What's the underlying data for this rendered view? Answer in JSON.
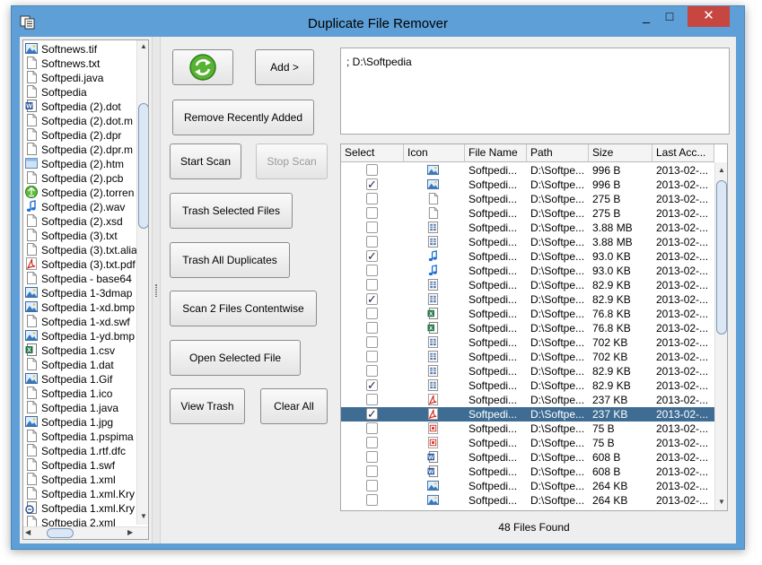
{
  "window": {
    "title": "Duplicate File Remover",
    "minimize": "_",
    "maximize": "□",
    "close": "✕"
  },
  "file_list": [
    {
      "name": "Softnews.tif",
      "icon": "image-icon"
    },
    {
      "name": "Softnews.txt",
      "icon": "text-file-icon"
    },
    {
      "name": "Softpedi.java",
      "icon": "text-file-icon"
    },
    {
      "name": "Softpedia",
      "icon": "text-file-icon"
    },
    {
      "name": "Softpedia (2).dot",
      "icon": "word-document-icon"
    },
    {
      "name": "Softpedia (2).dot.m",
      "icon": "text-file-icon"
    },
    {
      "name": "Softpedia (2).dpr",
      "icon": "text-file-icon"
    },
    {
      "name": "Softpedia (2).dpr.m",
      "icon": "text-file-icon"
    },
    {
      "name": "Softpedia (2).htm",
      "icon": "web-page-icon"
    },
    {
      "name": "Softpedia (2).pcb",
      "icon": "text-file-icon"
    },
    {
      "name": "Softpedia (2).torren",
      "icon": "torrent-icon"
    },
    {
      "name": "Softpedia (2).wav",
      "icon": "audio-icon"
    },
    {
      "name": "Softpedia (2).xsd",
      "icon": "text-file-icon"
    },
    {
      "name": "Softpedia (3).txt",
      "icon": "text-file-icon"
    },
    {
      "name": "Softpedia (3).txt.alia",
      "icon": "text-file-icon"
    },
    {
      "name": "Softpedia (3).txt.pdf",
      "icon": "pdf-icon"
    },
    {
      "name": "Softpedia - base64",
      "icon": "text-file-icon"
    },
    {
      "name": "Softpedia 1-3dmap",
      "icon": "image-icon"
    },
    {
      "name": "Softpedia 1-xd.bmp",
      "icon": "image-icon"
    },
    {
      "name": "Softpedia 1-xd.swf",
      "icon": "text-file-icon"
    },
    {
      "name": "Softpedia 1-yd.bmp",
      "icon": "image-icon"
    },
    {
      "name": "Softpedia 1.csv",
      "icon": "excel-icon"
    },
    {
      "name": "Softpedia 1.dat",
      "icon": "text-file-icon"
    },
    {
      "name": "Softpedia 1.Gif",
      "icon": "image-icon"
    },
    {
      "name": "Softpedia 1.ico",
      "icon": "text-file-icon"
    },
    {
      "name": "Softpedia 1.java",
      "icon": "text-file-icon"
    },
    {
      "name": "Softpedia 1.jpg",
      "icon": "image-icon"
    },
    {
      "name": "Softpedia 1.pspima",
      "icon": "text-file-icon"
    },
    {
      "name": "Softpedia 1.rtf.dfc",
      "icon": "text-file-icon"
    },
    {
      "name": "Softpedia 1.swf",
      "icon": "text-file-icon"
    },
    {
      "name": "Softpedia 1.xml",
      "icon": "text-file-icon"
    },
    {
      "name": "Softpedia 1.xml.Kry",
      "icon": "text-file-icon"
    },
    {
      "name": "Softpedia 1.xml.Kry",
      "icon": "script-icon"
    },
    {
      "name": "Softpedia 2.xml",
      "icon": "text-file-icon"
    }
  ],
  "buttons": {
    "add": "Add >",
    "remove_recent": "Remove Recently Added",
    "start_scan": "Start Scan",
    "stop_scan": "Stop Scan",
    "trash_selected": "Trash Selected Files",
    "trash_all": "Trash All Duplicates",
    "scan_contentwise": "Scan 2 Files Contentwise",
    "open_selected": "Open Selected File",
    "view_trash": "View Trash",
    "clear_all": "Clear All"
  },
  "path_box": {
    "text": "; D:\\Softpedia"
  },
  "table": {
    "columns": [
      "Select",
      "Icon",
      "File Name",
      "Path",
      "Size",
      "Last Acc..."
    ],
    "rows": [
      {
        "checked": false,
        "icon": "image-icon",
        "name": "Softpedi...",
        "path": "D:\\Softpe...",
        "size": "996 B",
        "date": "2013-02-..."
      },
      {
        "checked": true,
        "icon": "image-icon",
        "name": "Softpedi...",
        "path": "D:\\Softpe...",
        "size": "996 B",
        "date": "2013-02-..."
      },
      {
        "checked": false,
        "icon": "text-file-icon",
        "name": "Softpedi...",
        "path": "D:\\Softpe...",
        "size": "275 B",
        "date": "2013-02-..."
      },
      {
        "checked": false,
        "icon": "text-file-icon",
        "name": "Softpedi...",
        "path": "D:\\Softpe...",
        "size": "275 B",
        "date": "2013-02-..."
      },
      {
        "checked": false,
        "icon": "table-file-icon",
        "name": "Softpedi...",
        "path": "D:\\Softpe...",
        "size": "3.88 MB",
        "date": "2013-02-..."
      },
      {
        "checked": false,
        "icon": "table-file-icon",
        "name": "Softpedi...",
        "path": "D:\\Softpe...",
        "size": "3.88 MB",
        "date": "2013-02-..."
      },
      {
        "checked": true,
        "icon": "audio-icon",
        "name": "Softpedi...",
        "path": "D:\\Softpe...",
        "size": "93.0 KB",
        "date": "2013-02-..."
      },
      {
        "checked": false,
        "icon": "audio-icon",
        "name": "Softpedi...",
        "path": "D:\\Softpe...",
        "size": "93.0 KB",
        "date": "2013-02-..."
      },
      {
        "checked": false,
        "icon": "table-file-icon",
        "name": "Softpedi...",
        "path": "D:\\Softpe...",
        "size": "82.9 KB",
        "date": "2013-02-..."
      },
      {
        "checked": true,
        "icon": "table-file-icon",
        "name": "Softpedi...",
        "path": "D:\\Softpe...",
        "size": "82.9 KB",
        "date": "2013-02-..."
      },
      {
        "checked": false,
        "icon": "excel-icon",
        "name": "Softpedi...",
        "path": "D:\\Softpe...",
        "size": "76.8 KB",
        "date": "2013-02-..."
      },
      {
        "checked": false,
        "icon": "excel-icon",
        "name": "Softpedi...",
        "path": "D:\\Softpe...",
        "size": "76.8 KB",
        "date": "2013-02-..."
      },
      {
        "checked": false,
        "icon": "table-file-icon",
        "name": "Softpedi...",
        "path": "D:\\Softpe...",
        "size": "702 KB",
        "date": "2013-02-..."
      },
      {
        "checked": false,
        "icon": "table-file-icon",
        "name": "Softpedi...",
        "path": "D:\\Softpe...",
        "size": "702 KB",
        "date": "2013-02-..."
      },
      {
        "checked": false,
        "icon": "table-file-icon",
        "name": "Softpedi...",
        "path": "D:\\Softpe...",
        "size": "82.9 KB",
        "date": "2013-02-..."
      },
      {
        "checked": true,
        "icon": "table-file-icon",
        "name": "Softpedi...",
        "path": "D:\\Softpe...",
        "size": "82.9 KB",
        "date": "2013-02-..."
      },
      {
        "checked": false,
        "icon": "pdf-icon",
        "name": "Softpedi...",
        "path": "D:\\Softpe...",
        "size": "237 KB",
        "date": "2013-02-..."
      },
      {
        "checked": true,
        "icon": "pdf-icon",
        "name": "Softpedi...",
        "path": "D:\\Softpe...",
        "size": "237 KB",
        "date": "2013-02-...",
        "selected": true
      },
      {
        "checked": false,
        "icon": "pdf-doc-icon",
        "name": "Softpedi...",
        "path": "D:\\Softpe...",
        "size": "75 B",
        "date": "2013-02-..."
      },
      {
        "checked": false,
        "icon": "pdf-doc-icon",
        "name": "Softpedi...",
        "path": "D:\\Softpe...",
        "size": "75 B",
        "date": "2013-02-..."
      },
      {
        "checked": false,
        "icon": "word-document-icon",
        "name": "Softpedi...",
        "path": "D:\\Softpe...",
        "size": "608 B",
        "date": "2013-02-..."
      },
      {
        "checked": false,
        "icon": "word-document-icon",
        "name": "Softpedi...",
        "path": "D:\\Softpe...",
        "size": "608 B",
        "date": "2013-02-..."
      },
      {
        "checked": false,
        "icon": "image-icon",
        "name": "Softpedi...",
        "path": "D:\\Softpe...",
        "size": "264 KB",
        "date": "2013-02-..."
      },
      {
        "checked": false,
        "icon": "image-icon",
        "name": "Softpedi...",
        "path": "D:\\Softpe...",
        "size": "264 KB",
        "date": "2013-02-..."
      }
    ]
  },
  "status": {
    "text": "48 Files Found"
  },
  "colors": {
    "title_bar": "#5d9fd6",
    "close_button": "#c7463f",
    "selected_row": "#3f6c92"
  }
}
